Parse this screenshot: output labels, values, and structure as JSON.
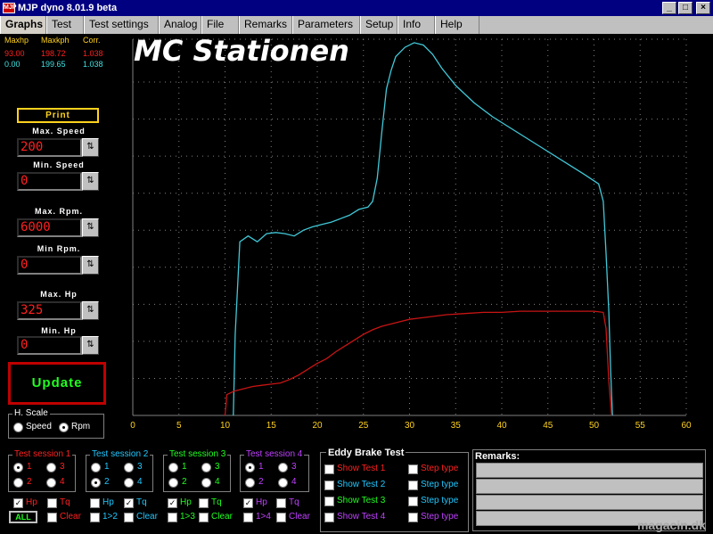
{
  "window": {
    "title": "MJP dyno 8.01.9 beta",
    "icon_text": "MJP"
  },
  "tabs": [
    "Graphs",
    "Test",
    "Test settings",
    "Analog",
    "File",
    "Remarks",
    "Parameters",
    "Setup",
    "Info",
    "Help"
  ],
  "stats": {
    "headers": [
      "Maxhp",
      "Maxkph",
      "Corr."
    ],
    "row1": [
      "93.00",
      "198.72",
      "1.038"
    ],
    "row2": [
      "0.00",
      "199.65",
      "1.038"
    ]
  },
  "controls": {
    "print": "Print",
    "max_speed_label": "Max. Speed",
    "max_speed": "200",
    "min_speed_label": "Min. Speed",
    "min_speed": "0",
    "max_rpm_label": "Max. Rpm.",
    "max_rpm": "6000",
    "min_rpm_label": "Min Rpm.",
    "min_rpm": "0",
    "max_hp_label": "Max. Hp",
    "max_hp": "325",
    "min_hp_label": "Min. Hp",
    "min_hp": "0",
    "update": "Update",
    "spin_icon": "spin-arrows-icon"
  },
  "chart_brand": "MC Stationen",
  "chart_data": {
    "type": "line",
    "xlim": [
      0,
      60
    ],
    "ylim": [
      0,
      325
    ],
    "x_ticks": [
      "0",
      "5",
      "10",
      "15",
      "20",
      "25",
      "30",
      "35",
      "40",
      "45",
      "50",
      "55",
      "60"
    ],
    "y_ticks": [
      "0",
      "32",
      "64",
      "96",
      "128",
      "160",
      "192",
      "224",
      "256",
      "288",
      "325"
    ],
    "grid": true,
    "series": [
      {
        "color": "#40c8d8",
        "points": [
          [
            10.9,
            0
          ],
          [
            11.1,
            70
          ],
          [
            11.6,
            150
          ],
          [
            12.5,
            155
          ],
          [
            13.5,
            150
          ],
          [
            14.5,
            157
          ],
          [
            15.5,
            158
          ],
          [
            16.5,
            157
          ],
          [
            17.5,
            155
          ],
          [
            18.5,
            160
          ],
          [
            19.5,
            163
          ],
          [
            20.5,
            165
          ],
          [
            21.5,
            167
          ],
          [
            22.5,
            170
          ],
          [
            23.5,
            173
          ],
          [
            24.5,
            178
          ],
          [
            25.5,
            180
          ],
          [
            26,
            185
          ],
          [
            26.5,
            205
          ],
          [
            27,
            245
          ],
          [
            27.5,
            282
          ],
          [
            28,
            298
          ],
          [
            28.5,
            310
          ],
          [
            29.5,
            318
          ],
          [
            30.5,
            322
          ],
          [
            31.5,
            320
          ],
          [
            32.5,
            312
          ],
          [
            33.5,
            300
          ],
          [
            35,
            285
          ],
          [
            37,
            270
          ],
          [
            39,
            258
          ],
          [
            41,
            248
          ],
          [
            43,
            238
          ],
          [
            45,
            228
          ],
          [
            47,
            218
          ],
          [
            49,
            208
          ],
          [
            50.5,
            200
          ],
          [
            51,
            185
          ],
          [
            51.3,
            140
          ],
          [
            51.6,
            90
          ],
          [
            51.8,
            40
          ],
          [
            52,
            0
          ]
        ]
      },
      {
        "color": "#c81414",
        "points": [
          [
            10,
            0
          ],
          [
            10.2,
            18
          ],
          [
            11,
            21
          ],
          [
            12,
            23
          ],
          [
            13,
            25
          ],
          [
            14,
            26
          ],
          [
            15,
            27
          ],
          [
            16,
            28
          ],
          [
            17,
            31
          ],
          [
            18,
            35
          ],
          [
            19,
            40
          ],
          [
            20,
            45
          ],
          [
            21,
            49
          ],
          [
            22,
            55
          ],
          [
            23,
            60
          ],
          [
            24,
            65
          ],
          [
            25,
            70
          ],
          [
            26,
            74
          ],
          [
            27,
            77
          ],
          [
            28,
            79
          ],
          [
            29,
            81
          ],
          [
            30,
            83
          ],
          [
            31,
            84
          ],
          [
            32,
            85
          ],
          [
            34,
            87
          ],
          [
            36,
            88
          ],
          [
            38,
            89
          ],
          [
            40,
            89
          ],
          [
            42,
            90
          ],
          [
            44,
            90
          ],
          [
            46,
            90
          ],
          [
            48,
            90
          ],
          [
            50,
            90
          ],
          [
            51,
            89
          ],
          [
            51.3,
            75
          ],
          [
            51.6,
            30
          ],
          [
            51.9,
            0
          ]
        ]
      }
    ]
  },
  "h_scale": {
    "label": "H. Scale",
    "speed": "Speed",
    "rpm": "Rpm"
  },
  "sessions": [
    {
      "title": "Test session 1",
      "color": "#ff2020",
      "r1": "1",
      "r2": "2",
      "r3": "3",
      "r4": "4",
      "hp": "Hp",
      "tq": "Tq",
      "clear": "Clear",
      "all": "ALL",
      "cmp": ""
    },
    {
      "title": "Test session 2",
      "color": "#20c8ff",
      "r1": "1",
      "r2": "2",
      "r3": "3",
      "r4": "4",
      "hp": "Hp",
      "tq": "Tq",
      "clear": "Clear",
      "cmp": "1>2"
    },
    {
      "title": "Test session 3",
      "color": "#20ff20",
      "r1": "1",
      "r2": "2",
      "r3": "3",
      "r4": "4",
      "hp": "Hp",
      "tq": "Tq",
      "clear": "Clear",
      "cmp": "1>3"
    },
    {
      "title": "Test session 4",
      "color": "#c040ff",
      "r1": "1",
      "r2": "2",
      "r3": "3",
      "r4": "4",
      "hp": "Hp",
      "tq": "Tq",
      "clear": "Clear",
      "cmp": "1>4"
    }
  ],
  "eddy": {
    "title": "Eddy Brake Test",
    "show1": "Show Test 1",
    "show2": "Show Test 2",
    "show3": "Show Test 3",
    "show4": "Show Test 4",
    "step": "Step type"
  },
  "remarks": {
    "title": "Remarks:"
  },
  "watermark": "magacin.dk"
}
